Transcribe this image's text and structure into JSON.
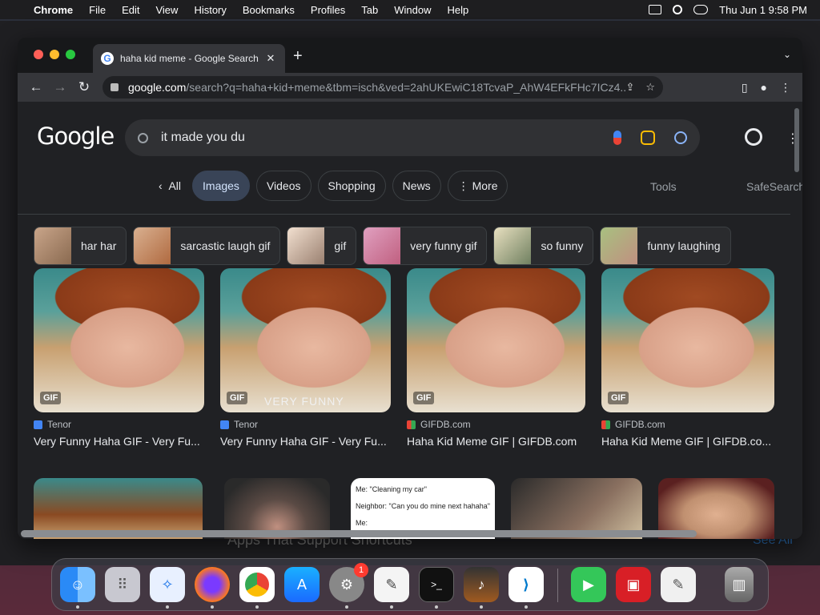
{
  "menubar": {
    "app": "Chrome",
    "items": [
      "File",
      "Edit",
      "View",
      "History",
      "Bookmarks",
      "Profiles",
      "Tab",
      "Window",
      "Help"
    ],
    "clock": "Thu Jun 1  9:58 PM"
  },
  "browser": {
    "tab_title": "haha kid meme - Google Search",
    "tab_close": "✕",
    "new_tab": "+",
    "url_host": "google.com",
    "url_rest": "/search?q=haha+kid+meme&tbm=isch&ved=2ahUKEwiC18TcvaP_AhW4EFkFHc7ICz4..."
  },
  "google": {
    "logo": "Google",
    "search_value": "it made you du",
    "filters": [
      {
        "label": "All"
      },
      {
        "label": "Images"
      },
      {
        "label": "Videos"
      },
      {
        "label": "Shopping"
      },
      {
        "label": "News"
      },
      {
        "label": "More"
      }
    ],
    "filters_prefix": "‹",
    "more_prefix": "⋮",
    "tools": "Tools",
    "safesearch": "SafeSearch",
    "suggestions": [
      "har har",
      "sarcastic laugh gif",
      "gif",
      "very funny gif",
      "so funny",
      "funny laughing"
    ],
    "results": [
      {
        "source": "Tenor",
        "title": "Very Funny Haha GIF - Very Fu...",
        "badge": "GIF",
        "overlay": ""
      },
      {
        "source": "Tenor",
        "title": "Very Funny Haha GIF - Very Fu...",
        "badge": "GIF",
        "overlay": "VERY FUNNY"
      },
      {
        "source": "GIFDB.com",
        "title": "Haha Kid Meme GIF | GIFDB.com",
        "badge": "GIF",
        "overlay": ""
      },
      {
        "source": "GIFDB.com",
        "title": "Haha Kid Meme GIF | GIFDB.co...",
        "badge": "GIF",
        "overlay": ""
      }
    ],
    "note_lines": [
      "Me: \"Cleaning my car\"",
      "Neighbor: \"Can you do mine next hahaha\"",
      "Me:"
    ]
  },
  "background_app": {
    "heading": "Apps That Support Shortcuts",
    "link": "See All"
  },
  "dock": {
    "items": [
      "finder-icon",
      "launchpad-icon",
      "safari-icon",
      "firefox-icon",
      "chrome-icon",
      "app-store-icon",
      "system-settings-icon",
      "textedit-icon",
      "terminal-icon",
      "garageband-icon",
      "vscode-icon",
      "facetime-icon",
      "photo-booth-icon",
      "script-editor-icon",
      "trash-icon"
    ],
    "settings_badge": "1"
  }
}
